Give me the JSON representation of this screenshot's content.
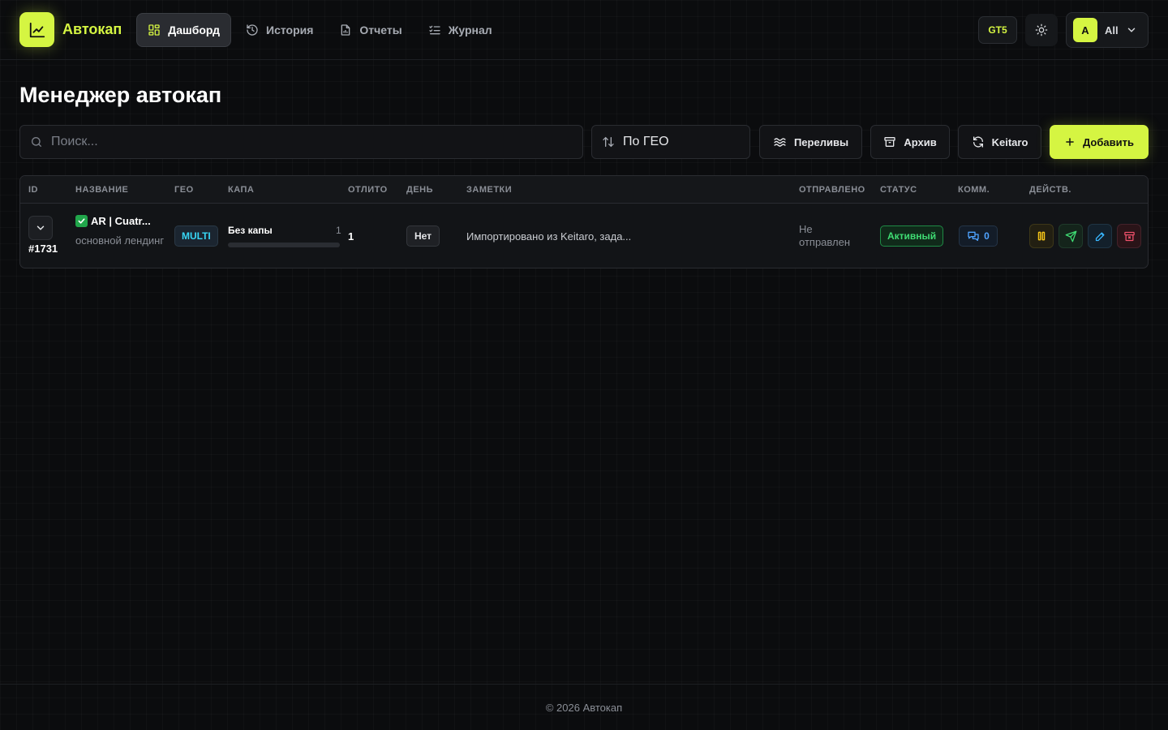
{
  "app": {
    "name": "Автокап",
    "accent": "#d5f542"
  },
  "nav": {
    "items": [
      {
        "label": "Дашборд",
        "icon": "grid-icon",
        "active": true
      },
      {
        "label": "История",
        "icon": "history-icon",
        "active": false
      },
      {
        "label": "Отчеты",
        "icon": "document-icon",
        "active": false
      },
      {
        "label": "Журнал",
        "icon": "list-check-icon",
        "active": false
      }
    ]
  },
  "header": {
    "badge": "GT5",
    "user_initial": "A",
    "user_label": "All"
  },
  "page": {
    "title": "Менеджер автокап"
  },
  "toolbar": {
    "search_placeholder": "Поиск...",
    "sort_label": "По ГЕО",
    "overflow_label": "Переливы",
    "archive_label": "Архив",
    "keitaro_label": "Keitaro",
    "add_label": "Добавить"
  },
  "table": {
    "headers": [
      "ID",
      "НАЗВАНИЕ",
      "ГЕО",
      "КАПА",
      "ОТЛИТО",
      "ДЕНЬ",
      "ЗАМЕТКИ",
      "ОТПРАВЛЕНО",
      "СТАТУС",
      "КОММ.",
      "ДЕЙСТВ."
    ],
    "rows": [
      {
        "id": "#1731",
        "name": "AR | Cuatr...",
        "subtitle": "основной лендинг",
        "geo": "MULTI",
        "cap_label": "Без капы",
        "cap_count": "1",
        "cap_fill_fraction": 0,
        "poured": "1",
        "day": "Нет",
        "notes": "Импортировано из Keitaro, зада...",
        "sent": "Не отправлен",
        "status": "Активный",
        "comments": "0"
      }
    ]
  },
  "footer": {
    "text": "© 2026 Автокап"
  }
}
